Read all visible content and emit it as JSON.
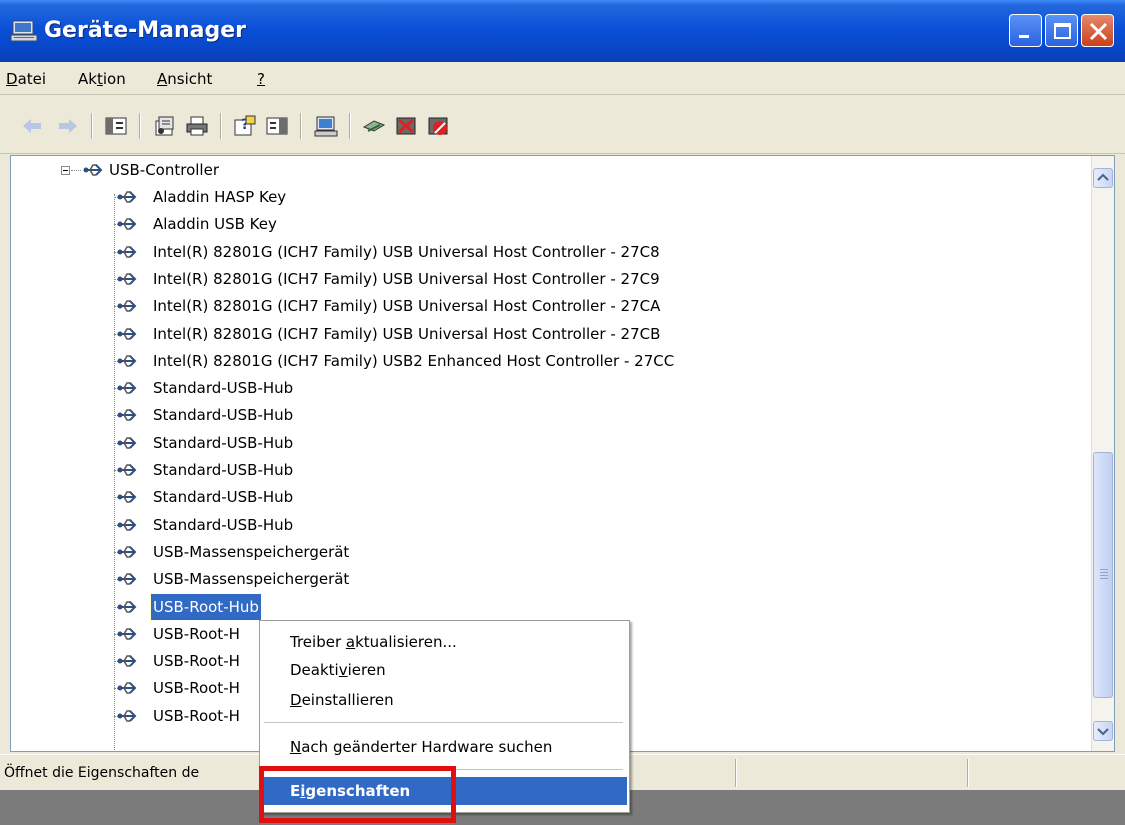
{
  "window": {
    "title": "Geräte-Manager"
  },
  "menubar": {
    "items": [
      {
        "pre": "",
        "ul": "D",
        "post": "atei"
      },
      {
        "pre": "Ak",
        "ul": "t",
        "post": "ion"
      },
      {
        "pre": "",
        "ul": "A",
        "post": "nsicht"
      },
      {
        "pre": "",
        "ul": "?",
        "post": ""
      }
    ]
  },
  "toolbar": {
    "icons": [
      "back-arrow-icon",
      "forward-arrow-icon",
      "console-tree-icon",
      "properties-icon",
      "print-icon",
      "help-icon",
      "action-pane-icon",
      "scan-hardware-icon",
      "update-driver-icon",
      "uninstall-icon",
      "disable-icon"
    ]
  },
  "tree": {
    "root_label": "USB-Controller",
    "devices": [
      "Aladdin HASP Key",
      "Aladdin USB Key",
      "Intel(R) 82801G (ICH7 Family) USB Universal Host Controller - 27C8",
      "Intel(R) 82801G (ICH7 Family) USB Universal Host Controller - 27C9",
      "Intel(R) 82801G (ICH7 Family) USB Universal Host Controller - 27CA",
      "Intel(R) 82801G (ICH7 Family) USB Universal Host Controller - 27CB",
      "Intel(R) 82801G (ICH7 Family) USB2 Enhanced Host Controller - 27CC",
      "Standard-USB-Hub",
      "Standard-USB-Hub",
      "Standard-USB-Hub",
      "Standard-USB-Hub",
      "Standard-USB-Hub",
      "Standard-USB-Hub",
      "USB-Massenspeichergerät",
      "USB-Massenspeichergerät",
      "USB-Root-Hub",
      "USB-Root-H",
      "USB-Root-H",
      "USB-Root-H",
      "USB-Root-H"
    ],
    "selected_index": 15
  },
  "context_menu": {
    "items": [
      {
        "pre": "Treiber ",
        "ul": "a",
        "post": "ktualisieren..."
      },
      {
        "pre": "Deakti",
        "ul": "v",
        "post": "ieren"
      },
      {
        "pre": "",
        "ul": "D",
        "post": "einstallieren"
      },
      {
        "pre": "",
        "ul": "N",
        "post": "ach geänderter Hardware suchen"
      },
      {
        "pre": "E",
        "ul": "i",
        "post": "genschaften"
      }
    ],
    "highlighted_index": 4
  },
  "statusbar": {
    "text": "Öffnet die Eigenschaften de"
  },
  "colors": {
    "titlebar": "#0a50d8",
    "selection": "#316ac5",
    "callout": "#e01010"
  }
}
